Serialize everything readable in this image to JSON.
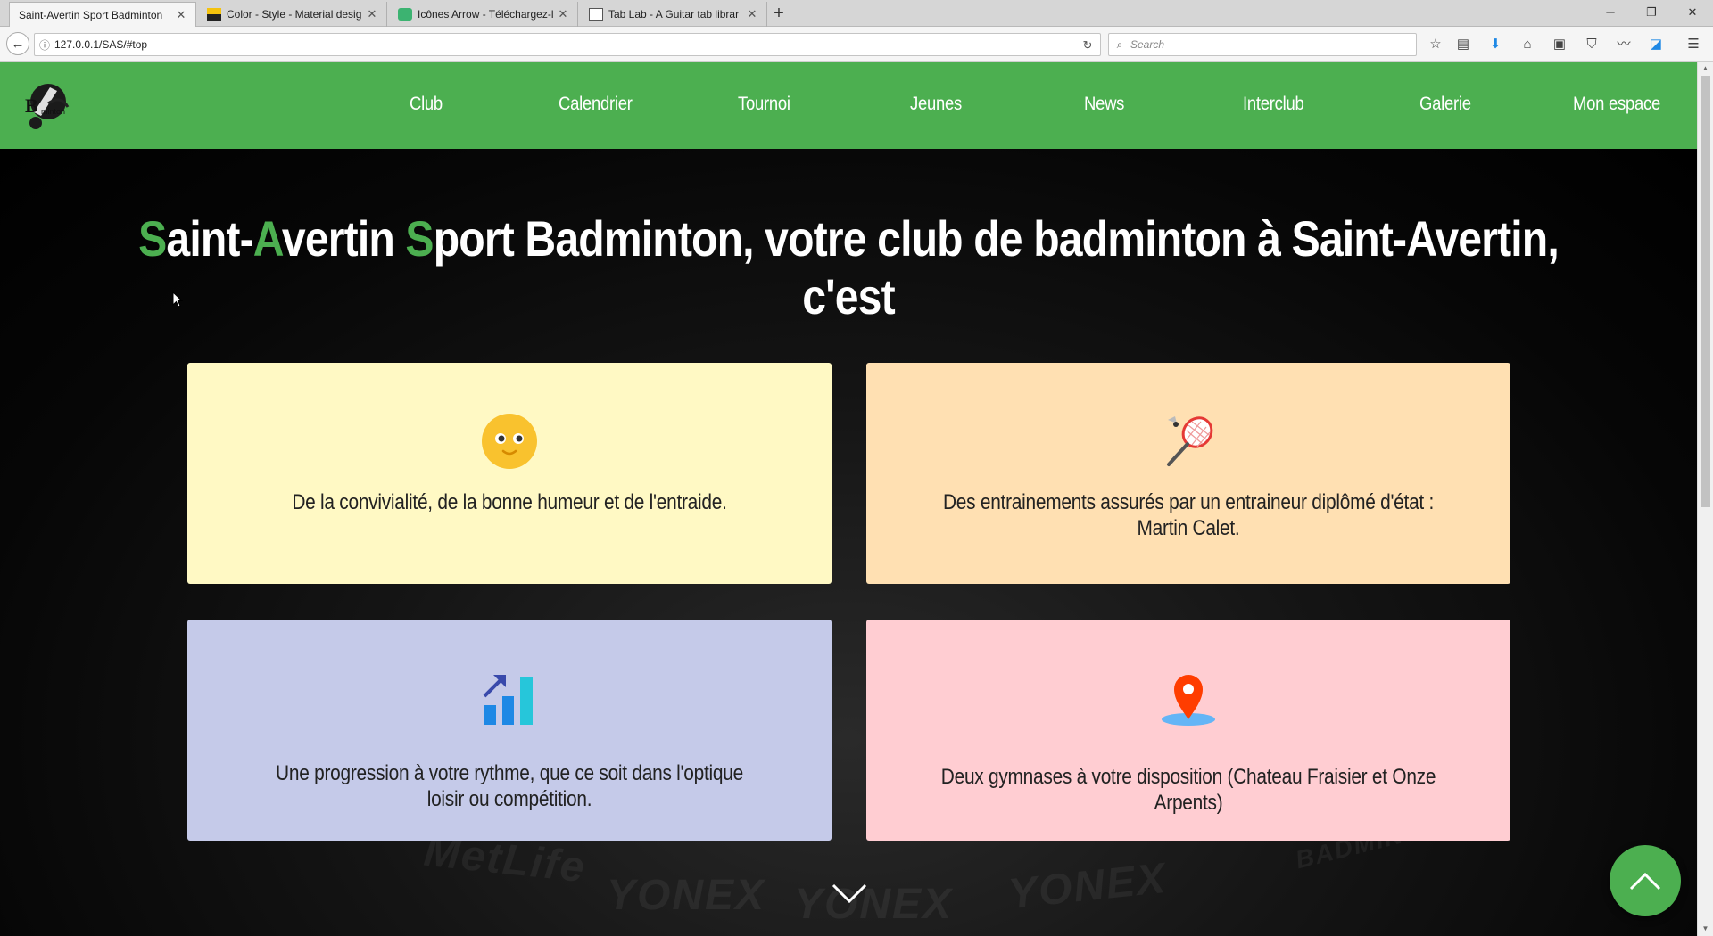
{
  "browser": {
    "tabs": [
      {
        "label": "Saint-Avertin Sport Badminton",
        "active": true
      },
      {
        "label": "Color - Style - Material desig",
        "active": false
      },
      {
        "label": "Icônes Arrow - Téléchargez-l",
        "active": false
      },
      {
        "label": "Tab Lab - A Guitar tab librar",
        "active": false
      }
    ],
    "new_tab_label": "+",
    "url": "127.0.0.1/SAS/#top",
    "search_placeholder": "Search"
  },
  "header": {
    "menu": [
      "Club",
      "Calendrier",
      "Tournoi",
      "Jeunes",
      "News",
      "Interclub",
      "Galerie",
      "Mon espace"
    ]
  },
  "hero": {
    "title_parts": [
      "S",
      "aint-",
      "A",
      "vertin ",
      "S",
      "port Badminton, votre club de badminton à Saint-Avertin, c'est"
    ],
    "cards": [
      {
        "icon": "smiley-icon",
        "text": "De la convivialité, de la bonne humeur et de l'entraide.",
        "color": "#fff9c4"
      },
      {
        "icon": "badminton-racket-icon",
        "text": "Des entrainements assurés par un entraineur diplômé d'état : Martin Calet.",
        "color": "#ffe0b2"
      },
      {
        "icon": "progress-chart-icon",
        "text": "Une progression à votre rythme, que ce soit dans l'optique loisir ou compétition.",
        "color": "#c5cae9"
      },
      {
        "icon": "location-pin-icon",
        "text": "Deux gymnases à votre disposition (Chateau Fraisier et Onze Arpents)",
        "color": "#ffcdd2"
      }
    ],
    "background_text": [
      "YONEX",
      "MetLife",
      "YONEX",
      "YONEX",
      "BADMINTON"
    ]
  },
  "colors": {
    "brand_green": "#4caf50",
    "black": "#000000"
  }
}
